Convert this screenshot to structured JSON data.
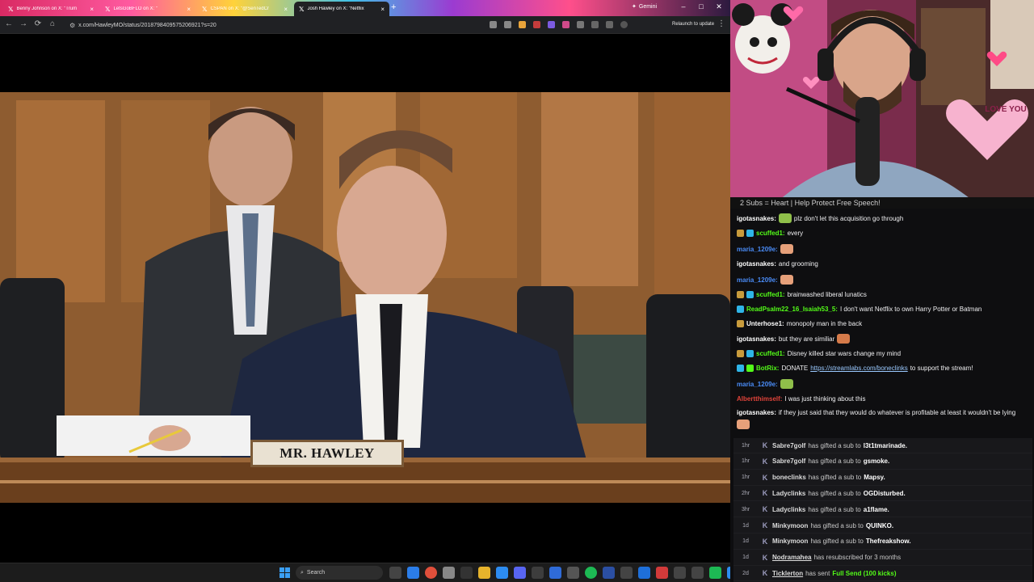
{
  "browser": {
    "tabs": [
      {
        "label": "Benny Johnson on X: \"Trum",
        "active": false
      },
      {
        "label": "LetsGoBFLO on X: \"",
        "active": false
      },
      {
        "label": "CSPAN on X: \"@SenTedCr",
        "active": false
      },
      {
        "label": "Josh Hawley on X: \"Netflix",
        "active": true
      }
    ],
    "new_tab": "+",
    "gemini_label": "Gemini",
    "url": "x.com/HawleyMO/status/2018798409575206921?s=20",
    "relaunch_label": "Relaunch to update",
    "window_controls": [
      "–",
      "□",
      "✕"
    ],
    "nav": [
      "←",
      "→",
      "⟳",
      "⌂"
    ],
    "toolbar_icons": [
      "⌘",
      "☆"
    ]
  },
  "video": {
    "nameplate": "MR. HAWLEY"
  },
  "taskbar": {
    "search_placeholder": "Search"
  },
  "stream": {
    "banner": "2 Subs = Heart | Help Protect Free Speech!",
    "webcam_sign": "LOVE YOU"
  },
  "chat": [
    {
      "user": "igotasnakes",
      "color": "#ffffff",
      "text": "plz don't let this acquisition go through",
      "badges": [],
      "emote_before": true
    },
    {
      "user": "scuffed1",
      "color": "#53fc18",
      "text": "every",
      "badges": [
        "#c89b3c",
        "#2fb5e8"
      ]
    },
    {
      "user": "maria_1209e",
      "color": "#4a8cf7",
      "text": "",
      "badges": [],
      "emote_after": true
    },
    {
      "user": "igotasnakes",
      "color": "#ffffff",
      "text": "and grooming",
      "badges": []
    },
    {
      "user": "maria_1209e",
      "color": "#4a8cf7",
      "text": "",
      "badges": [],
      "emote_after": true
    },
    {
      "user": "scuffed1",
      "color": "#53fc18",
      "text": "brainwashed liberal lunatics",
      "badges": [
        "#c89b3c",
        "#2fb5e8"
      ]
    },
    {
      "user": "ReadPsalm22_16_Isaiah53_5",
      "color": "#53fc18",
      "text": "I don't want Netflix to own Harry Potter or Batman",
      "badges": [
        "#2fb5e8"
      ]
    },
    {
      "user": "Unterhose1",
      "color": "#ffffff",
      "text": "monopoly man in the back",
      "badges": [
        "#c89b3c"
      ]
    },
    {
      "user": "igotasnakes",
      "color": "#ffffff",
      "text": "but they are similiar",
      "badges": [],
      "emote_after": true
    },
    {
      "user": "scuffed1",
      "color": "#53fc18",
      "text": "Disney killed star wars change my mind",
      "badges": [
        "#c89b3c",
        "#2fb5e8"
      ]
    },
    {
      "user": "BotRix",
      "color": "#53fc18",
      "text": "DONATE",
      "link": "https://streamlabs.com/boneclinks",
      "text_after": "to support the stream!",
      "badges": [
        "#2fb5e8",
        "#53fc18"
      ]
    },
    {
      "user": "maria_1209e",
      "color": "#4a8cf7",
      "text": "",
      "badges": [],
      "emote_after": true
    },
    {
      "user": "Albertthimself",
      "color": "#e0433a",
      "text": "I was just thinking about this",
      "badges": []
    },
    {
      "user": "igotasnakes",
      "color": "#ffffff",
      "text": "if they just said that they would do whatever is profitable at least it wouldn't be lying",
      "badges": [],
      "emote_after": true
    }
  ],
  "events": [
    {
      "age": "1hr",
      "who": "Sabre7golf",
      "action": "has gifted a sub to",
      "target": "l3t1tmarinade."
    },
    {
      "age": "1hr",
      "who": "Sabre7golf",
      "action": "has gifted a sub to",
      "target": "gsmoke."
    },
    {
      "age": "1hr",
      "who": "boneclinks",
      "action": "has gifted a sub to",
      "target": "Mapsy."
    },
    {
      "age": "2hr",
      "who": "Ladyclinks",
      "action": "has gifted a sub to",
      "target": "OGDisturbed."
    },
    {
      "age": "3hr",
      "who": "Ladyclinks",
      "action": "has gifted a sub to",
      "target": "a1flame."
    },
    {
      "age": "1d",
      "who": "Minkymoon",
      "action": "has gifted a sub to",
      "target": "QUINKO."
    },
    {
      "age": "1d",
      "who": "Minkymoon",
      "action": "has gifted a sub to",
      "target": "Thefreakshow."
    },
    {
      "age": "1d",
      "who": "Nodramahea",
      "action": "has resubscribed for 3 months",
      "target": ""
    },
    {
      "age": "2d",
      "who": "Ticklerton",
      "action": "has sent",
      "target": "",
      "green": "Full Send (100 kicks)"
    }
  ]
}
